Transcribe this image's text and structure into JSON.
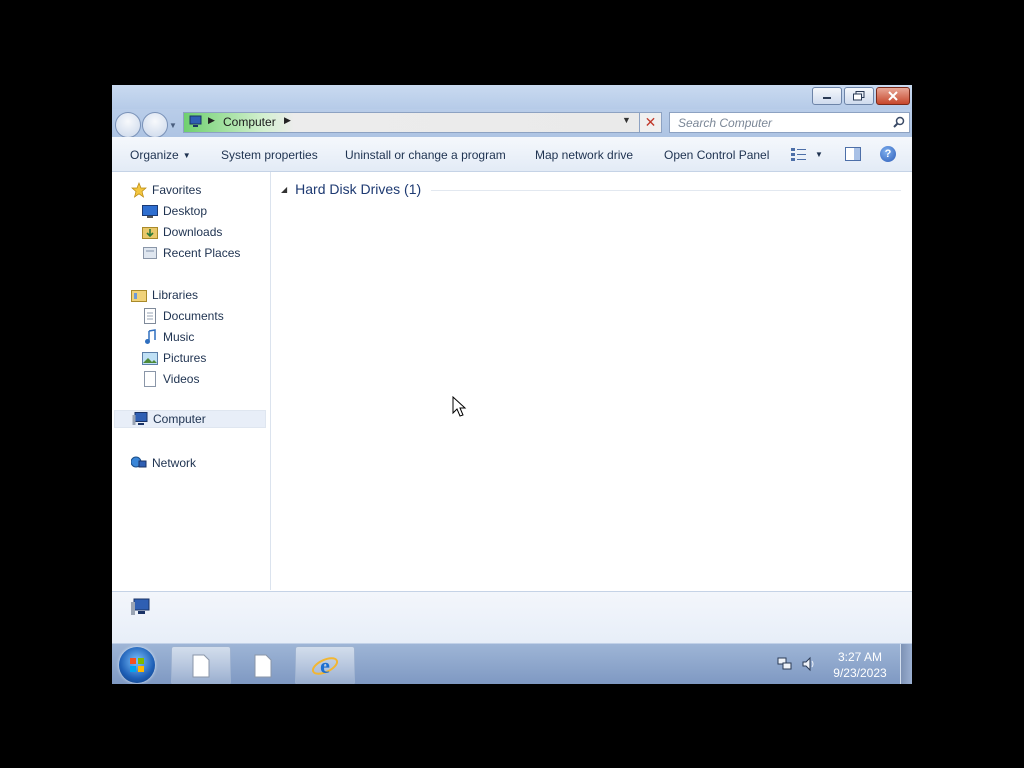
{
  "window": {
    "controls": {
      "minimize_icon": "minimize-icon",
      "restore_icon": "restore-icon",
      "close_icon": "close-icon"
    }
  },
  "address": {
    "path": "Computer",
    "search_placeholder": "Search Computer"
  },
  "commands": {
    "organize": "Organize",
    "system_properties": "System properties",
    "uninstall": "Uninstall or change a program",
    "map_drive": "Map network drive",
    "control_panel": "Open Control Panel",
    "help": "?"
  },
  "nav": {
    "favorites": "Favorites",
    "desktop": "Desktop",
    "downloads": "Downloads",
    "recent_places": "Recent Places",
    "libraries": "Libraries",
    "documents": "Documents",
    "music": "Music",
    "pictures": "Pictures",
    "videos": "Videos",
    "computer": "Computer",
    "network": "Network"
  },
  "content": {
    "group_label": "Hard Disk Drives (1)"
  },
  "taskbar": {
    "time": "3:27 AM",
    "date": "9/23/2023"
  },
  "colors": {
    "accent": "#1e3a72",
    "taskbar": "#8aa3c9",
    "close": "#c7472c"
  }
}
